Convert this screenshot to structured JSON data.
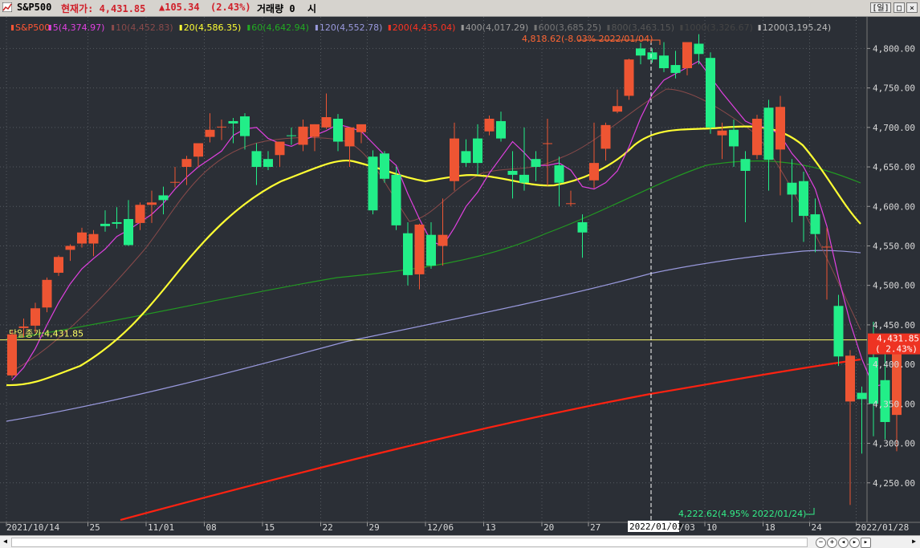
{
  "header": {
    "symbol": "S&P500",
    "price_label": "현재가: 4,431.85",
    "change_label": "▲105.34",
    "change_pct": "(2.43%)",
    "volume_label": "거래량 0",
    "time_label": "시",
    "daily_btn": "[일]"
  },
  "ma_legend": [
    {
      "label": "S&P500",
      "color": "#ff5533"
    },
    {
      "label": "5(4,374.97)",
      "color": "#e040e0"
    },
    {
      "label": "10(4,452.83)",
      "color": "#8a4a4a"
    },
    {
      "label": "20(4,586.35)",
      "color": "#ffff33"
    },
    {
      "label": "60(4,642.94)",
      "color": "#22aa22"
    },
    {
      "label": "120(4,552.78)",
      "color": "#9999dd"
    },
    {
      "label": "200(4,435.04)",
      "color": "#ff3322"
    },
    {
      "label": "400(4,017.29)",
      "color": "#999999"
    },
    {
      "label": "600(3,685.25)",
      "color": "#777777"
    },
    {
      "label": "800(3,463.15)",
      "color": "#555555"
    },
    {
      "label": "1000(3,326.67)",
      "color": "#444444"
    },
    {
      "label": "1200(3,195.24)",
      "color": "#bbbbbb"
    }
  ],
  "annotations": {
    "high": "4,818.62(-8.03% 2022/01/04)",
    "low": "4,222.62(4.95% 2022/01/24)",
    "close_line": "당일종가:4,431.85",
    "price_tag": "4,431.85",
    "pct_tag": "( 2.43%)",
    "crosshair_date": "2022/01/03"
  },
  "colors": {
    "up": "#ee5533",
    "down": "#22ee88",
    "ma5": "#e040e0",
    "ma10": "#8a4a4a",
    "ma20": "#ffff33",
    "ma60": "#229922",
    "ma120": "#9999dd",
    "ma200": "#ff2211",
    "close_line": "#ffff66"
  },
  "chart_data": {
    "type": "candlestick",
    "ylim": [
      4200,
      4840
    ],
    "y_ticks": [
      "4,250.00",
      "4,300.00",
      "4,350.00",
      "4,400.00",
      "4,450.00",
      "4,500.00",
      "4,550.00",
      "4,600.00",
      "4,650.00",
      "4,700.00",
      "4,750.00",
      "4,800.00"
    ],
    "y_tick_values": [
      4250,
      4300,
      4350,
      4400,
      4450,
      4500,
      4550,
      4600,
      4650,
      4700,
      4750,
      4800
    ],
    "x_ticks": [
      {
        "label": "2021/10/14",
        "i": 0
      },
      {
        "label": "25",
        "i": 7
      },
      {
        "label": "11/01",
        "i": 12
      },
      {
        "label": "08",
        "i": 17
      },
      {
        "label": "15",
        "i": 22
      },
      {
        "label": "22",
        "i": 27
      },
      {
        "label": "29",
        "i": 31
      },
      {
        "label": "12/06",
        "i": 36
      },
      {
        "label": "13",
        "i": 41
      },
      {
        "label": "20",
        "i": 46
      },
      {
        "label": "27",
        "i": 50
      },
      {
        "label": "2022/01/03",
        "i": 54
      },
      {
        "label": "/03",
        "i": 57
      },
      {
        "label": "10",
        "i": 60
      },
      {
        "label": "18",
        "i": 65
      },
      {
        "label": "24",
        "i": 69
      },
      {
        "label": "2022/01/28",
        "i": 73
      }
    ],
    "candles": [
      [
        4386,
        4443,
        4383,
        4438
      ],
      [
        4446,
        4458,
        4434,
        4448
      ],
      [
        4449,
        4478,
        4440,
        4471
      ],
      [
        4472,
        4510,
        4466,
        4507
      ],
      [
        4516,
        4538,
        4512,
        4536
      ],
      [
        4545,
        4552,
        4531,
        4550
      ],
      [
        4553,
        4573,
        4548,
        4567
      ],
      [
        4553,
        4570,
        4537,
        4565
      ],
      [
        4578,
        4595,
        4568,
        4575
      ],
      [
        4580,
        4599,
        4572,
        4578
      ],
      [
        4584,
        4608,
        4550,
        4551
      ],
      [
        4579,
        4605,
        4570,
        4602
      ],
      [
        4602,
        4620,
        4579,
        4605
      ],
      [
        4614,
        4625,
        4590,
        4608
      ],
      [
        4630,
        4650,
        4624,
        4631
      ],
      [
        4650,
        4664,
        4627,
        4660
      ],
      [
        4663,
        4680,
        4650,
        4680
      ],
      [
        4688,
        4718,
        4681,
        4697
      ],
      [
        4701,
        4710,
        4684,
        4701
      ],
      [
        4708,
        4712,
        4680,
        4705
      ],
      [
        4714,
        4718,
        4672,
        4689
      ],
      [
        4670,
        4680,
        4627,
        4650
      ],
      [
        4660,
        4670,
        4646,
        4650
      ],
      [
        4665,
        4680,
        4650,
        4682
      ],
      [
        4690,
        4700,
        4678,
        4689
      ],
      [
        4678,
        4710,
        4670,
        4701
      ],
      [
        4688,
        4704,
        4670,
        4704
      ],
      [
        4700,
        4743,
        4698,
        4713
      ],
      [
        4711,
        4717,
        4670,
        4682
      ],
      [
        4676,
        4700,
        4650,
        4700
      ],
      [
        4694,
        4701,
        4680,
        4704
      ],
      [
        4663,
        4671,
        4590,
        4595
      ],
      [
        4667,
        4670,
        4630,
        4635
      ],
      [
        4640,
        4650,
        4570,
        4576
      ],
      [
        4566,
        4580,
        4500,
        4513
      ],
      [
        4514,
        4578,
        4495,
        4577
      ],
      [
        4564,
        4580,
        4521,
        4525
      ],
      [
        4550,
        4610,
        4525,
        4564
      ],
      [
        4632,
        4706,
        4620,
        4686
      ],
      [
        4670,
        4685,
        4650,
        4655
      ],
      [
        4686,
        4704,
        4640,
        4655
      ],
      [
        4695,
        4715,
        4690,
        4711
      ],
      [
        4708,
        4720,
        4682,
        4686
      ],
      [
        4645,
        4670,
        4610,
        4640
      ],
      [
        4640,
        4700,
        4620,
        4630
      ],
      [
        4660,
        4670,
        4632,
        4650
      ],
      [
        4680,
        4711,
        4626,
        4680
      ],
      [
        4652,
        4663,
        4600,
        4630
      ],
      [
        4604,
        4620,
        4600,
        4604
      ],
      [
        4580,
        4590,
        4535,
        4567
      ],
      [
        4633,
        4706,
        4623,
        4655
      ],
      [
        4673,
        4706,
        4658,
        4703
      ],
      [
        4720,
        4748,
        4718,
        4727
      ],
      [
        4740,
        4787,
        4735,
        4786
      ],
      [
        4800,
        4807,
        4780,
        4791
      ],
      [
        4795,
        4800,
        4782,
        4786
      ],
      [
        4791,
        4808,
        4770,
        4775
      ],
      [
        4779,
        4797,
        4762,
        4769
      ],
      [
        4775,
        4797,
        4766,
        4808
      ],
      [
        4806,
        4818,
        4780,
        4793
      ],
      [
        4788,
        4795,
        4692,
        4700
      ],
      [
        4690,
        4706,
        4660,
        4696
      ],
      [
        4697,
        4710,
        4650,
        4676
      ],
      [
        4660,
        4670,
        4580,
        4645
      ],
      [
        4665,
        4716,
        4660,
        4711
      ],
      [
        4725,
        4735,
        4620,
        4659
      ],
      [
        4672,
        4740,
        4614,
        4726
      ],
      [
        4630,
        4660,
        4580,
        4615
      ],
      [
        4632,
        4644,
        4555,
        4588
      ],
      [
        4590,
        4610,
        4542,
        4565
      ],
      [
        4548,
        4573,
        4482,
        4549
      ],
      [
        4474,
        4488,
        4398,
        4410
      ],
      [
        4353,
        4418,
        4222,
        4411
      ],
      [
        4364,
        4372,
        4287,
        4356
      ],
      [
        4409,
        4454,
        4309,
        4350
      ],
      [
        4380,
        4428,
        4305,
        4327
      ],
      [
        4336,
        4433,
        4290,
        4431
      ]
    ],
    "ma5": [
      4380,
      4396,
      4420,
      4450,
      4478,
      4502,
      4521,
      4534,
      4546,
      4562,
      4570,
      4580,
      4590,
      4604,
      4622,
      4637,
      4650,
      4660,
      4670,
      4690,
      4698,
      4700,
      4686,
      4680,
      4676,
      4683,
      4690,
      4696,
      4704,
      4700,
      4695,
      4680,
      4665,
      4652,
      4616,
      4584,
      4556,
      4550,
      4573,
      4600,
      4618,
      4642,
      4662,
      4682,
      4668,
      4652,
      4652,
      4655,
      4646,
      4625,
      4622,
      4630,
      4645,
      4675,
      4712,
      4742,
      4760,
      4768,
      4776,
      4784,
      4764,
      4744,
      4726,
      4708,
      4701,
      4700,
      4690,
      4667,
      4650,
      4622,
      4575,
      4510,
      4453,
      4407,
      4372,
      4375
    ]
  }
}
